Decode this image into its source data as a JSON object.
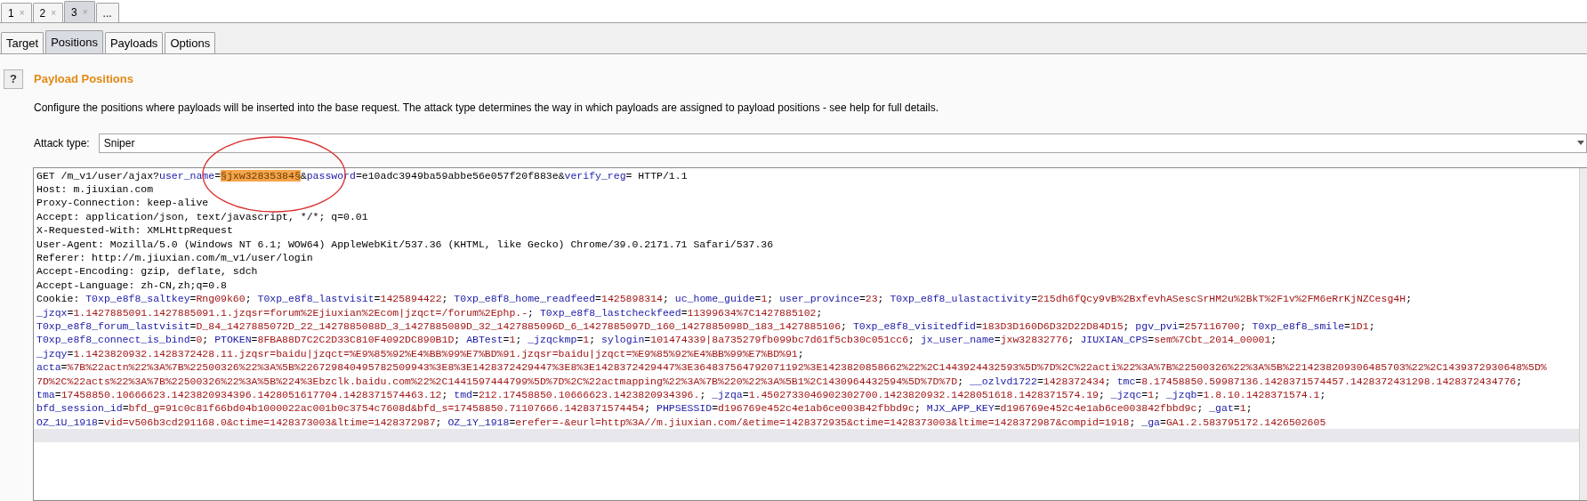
{
  "top_tabs": [
    {
      "label": "1",
      "close": "×",
      "selected": false
    },
    {
      "label": "2",
      "close": "×",
      "selected": false
    },
    {
      "label": "3",
      "close": "×",
      "selected": true
    },
    {
      "label": "...",
      "selected": false
    }
  ],
  "sub_tabs": [
    {
      "label": "Target",
      "selected": false
    },
    {
      "label": "Positions",
      "selected": true
    },
    {
      "label": "Payloads",
      "selected": false
    },
    {
      "label": "Options",
      "selected": false
    }
  ],
  "help_button": "?",
  "section_title": "Payload Positions",
  "description": "Configure the positions where payloads will be inserted into the base request. The attack type determines the way in which payloads are assigned to payload positions - see help for full details.",
  "attack_type": {
    "label": "Attack type:",
    "value": "Sniper"
  },
  "request_lines": [
    [
      {
        "kind": "plain",
        "text": "GET /m_v1/user/ajax?"
      },
      {
        "kind": "name",
        "text": "user_name"
      },
      {
        "kind": "plain",
        "text": "="
      },
      {
        "kind": "marker",
        "text": "§jxw32835384§"
      },
      {
        "kind": "plain",
        "text": "&"
      },
      {
        "kind": "name",
        "text": "password"
      },
      {
        "kind": "plain",
        "text": "=e10adc3949ba59abbe56e057f20f883e&"
      },
      {
        "kind": "name",
        "text": "verify_reg"
      },
      {
        "kind": "plain",
        "text": "= HTTP/1.1"
      }
    ],
    [
      {
        "kind": "plain",
        "text": "Host: m.jiuxian.com"
      }
    ],
    [
      {
        "kind": "plain",
        "text": "Proxy-Connection: keep-alive"
      }
    ],
    [
      {
        "kind": "plain",
        "text": "Accept: application/json, text/javascript, */*; q=0.01"
      }
    ],
    [
      {
        "kind": "plain",
        "text": "X-Requested-With: XMLHttpRequest"
      }
    ],
    [
      {
        "kind": "plain",
        "text": "User-Agent: Mozilla/5.0 (Windows NT 6.1; WOW64) AppleWebKit/537.36 (KHTML, like Gecko) Chrome/39.0.2171.71 Safari/537.36"
      }
    ],
    [
      {
        "kind": "plain",
        "text": "Referer: http://m.jiuxian.com/m_v1/user/login"
      }
    ],
    [
      {
        "kind": "plain",
        "text": "Accept-Encoding: gzip, deflate, sdch"
      }
    ],
    [
      {
        "kind": "plain",
        "text": "Accept-Language: zh-CN,zh;q=0.8"
      }
    ],
    [
      {
        "kind": "plain",
        "text": "Cookie: "
      },
      {
        "kind": "name",
        "text": "T0xp_e8f8_saltkey"
      },
      {
        "kind": "plain",
        "text": "="
      },
      {
        "kind": "value",
        "text": "Rng09k60"
      },
      {
        "kind": "plain",
        "text": "; "
      },
      {
        "kind": "name",
        "text": "T0xp_e8f8_lastvisit"
      },
      {
        "kind": "plain",
        "text": "="
      },
      {
        "kind": "value",
        "text": "1425894422"
      },
      {
        "kind": "plain",
        "text": "; "
      },
      {
        "kind": "name",
        "text": "T0xp_e8f8_home_readfeed"
      },
      {
        "kind": "plain",
        "text": "="
      },
      {
        "kind": "value",
        "text": "1425898314"
      },
      {
        "kind": "plain",
        "text": "; "
      },
      {
        "kind": "name",
        "text": "uc_home_guide"
      },
      {
        "kind": "plain",
        "text": "="
      },
      {
        "kind": "value",
        "text": "1"
      },
      {
        "kind": "plain",
        "text": "; "
      },
      {
        "kind": "name",
        "text": "user_province"
      },
      {
        "kind": "plain",
        "text": "="
      },
      {
        "kind": "value",
        "text": "23"
      },
      {
        "kind": "plain",
        "text": "; "
      },
      {
        "kind": "name",
        "text": "T0xp_e8f8_ulastactivity"
      },
      {
        "kind": "plain",
        "text": "="
      },
      {
        "kind": "value",
        "text": "215dh6fQcy9vB%2BxfevhASescSrHM2u%2BkT%2F1v%2FM6eRrKjNZCesg4H"
      },
      {
        "kind": "plain",
        "text": ";"
      }
    ],
    [
      {
        "kind": "name",
        "text": "_jzqx"
      },
      {
        "kind": "plain",
        "text": "="
      },
      {
        "kind": "value",
        "text": "1.1427885091.1427885091.1.jzqsr=forum%2Ejiuxian%2Ecom|jzqct=/forum%2Ephp.-"
      },
      {
        "kind": "plain",
        "text": "; "
      },
      {
        "kind": "name",
        "text": "T0xp_e8f8_lastcheckfeed"
      },
      {
        "kind": "plain",
        "text": "="
      },
      {
        "kind": "value",
        "text": "11399634%7C1427885102"
      },
      {
        "kind": "plain",
        "text": ";"
      }
    ],
    [
      {
        "kind": "name",
        "text": "T0xp_e8f8_forum_lastvisit"
      },
      {
        "kind": "plain",
        "text": "="
      },
      {
        "kind": "value",
        "text": "D_84_1427885072D_22_1427885088D_3_1427885089D_32_1427885096D_6_1427885097D_160_1427885098D_183_1427885106"
      },
      {
        "kind": "plain",
        "text": "; "
      },
      {
        "kind": "name",
        "text": "T0xp_e8f8_visitedfid"
      },
      {
        "kind": "plain",
        "text": "="
      },
      {
        "kind": "value",
        "text": "183D3D160D6D32D22D84D15"
      },
      {
        "kind": "plain",
        "text": "; "
      },
      {
        "kind": "name",
        "text": "pgv_pvi"
      },
      {
        "kind": "plain",
        "text": "="
      },
      {
        "kind": "value",
        "text": "257116700"
      },
      {
        "kind": "plain",
        "text": "; "
      },
      {
        "kind": "name",
        "text": "T0xp_e8f8_smile"
      },
      {
        "kind": "plain",
        "text": "="
      },
      {
        "kind": "value",
        "text": "1D1"
      },
      {
        "kind": "plain",
        "text": ";"
      }
    ],
    [
      {
        "kind": "name",
        "text": "T0xp_e8f8_connect_is_bind"
      },
      {
        "kind": "plain",
        "text": "="
      },
      {
        "kind": "value",
        "text": "0"
      },
      {
        "kind": "plain",
        "text": "; "
      },
      {
        "kind": "name",
        "text": "PTOKEN"
      },
      {
        "kind": "plain",
        "text": "="
      },
      {
        "kind": "value",
        "text": "8FBA88D7C2C2D33C810F4092DC890B1D"
      },
      {
        "kind": "plain",
        "text": "; "
      },
      {
        "kind": "name",
        "text": "ABTest"
      },
      {
        "kind": "plain",
        "text": "="
      },
      {
        "kind": "value",
        "text": "1"
      },
      {
        "kind": "plain",
        "text": "; "
      },
      {
        "kind": "name",
        "text": "_jzqckmp"
      },
      {
        "kind": "plain",
        "text": "="
      },
      {
        "kind": "value",
        "text": "1"
      },
      {
        "kind": "plain",
        "text": "; "
      },
      {
        "kind": "name",
        "text": "sylogin"
      },
      {
        "kind": "plain",
        "text": "="
      },
      {
        "kind": "value",
        "text": "101474339|8a735279fb099bc7d61f5cb30c051cc6"
      },
      {
        "kind": "plain",
        "text": "; "
      },
      {
        "kind": "name",
        "text": "jx_user_name"
      },
      {
        "kind": "plain",
        "text": "="
      },
      {
        "kind": "value",
        "text": "jxw32832776"
      },
      {
        "kind": "plain",
        "text": "; "
      },
      {
        "kind": "name",
        "text": "JIUXIAN_CPS"
      },
      {
        "kind": "plain",
        "text": "="
      },
      {
        "kind": "value",
        "text": "sem%7Cbt_2014_00001"
      },
      {
        "kind": "plain",
        "text": ";"
      }
    ],
    [
      {
        "kind": "name",
        "text": "_jzqy"
      },
      {
        "kind": "plain",
        "text": "="
      },
      {
        "kind": "value",
        "text": "1.1423820932.1428372428.11.jzqsr=baidu|jzqct=%E9%85%92%E4%BB%99%E7%BD%91.jzqsr=baidu|jzqct=%E9%85%92%E4%BB%99%E7%BD%91"
      },
      {
        "kind": "plain",
        "text": ";"
      }
    ],
    [
      {
        "kind": "name",
        "text": "acta"
      },
      {
        "kind": "plain",
        "text": "="
      },
      {
        "kind": "value",
        "text": "%7B%22actn%22%3A%7B%22500326%22%3A%5B%226729840495782509943%3E8%3E1428372429447%3E8%3E1428372429447%3E364837564792071192%3E1423820858662%22%2C1443924432593%5D%7D%2C%22acti%22%3A%7B%22500326%22%3A%5B%2214238209306485703%22%2C1439372930648%5D%"
      }
    ],
    [
      {
        "kind": "value",
        "text": "7D%2C%22acts%22%3A%7B%22500326%22%3A%5B%224%3Ebzclk.baidu.com%22%2C1441597444799%5D%7D%2C%22actmapping%22%3A%7B%220%22%3A%5B1%2C1430964432594%5D%7D%7D"
      },
      {
        "kind": "plain",
        "text": "; "
      },
      {
        "kind": "name",
        "text": "__ozlvd1722"
      },
      {
        "kind": "plain",
        "text": "="
      },
      {
        "kind": "value",
        "text": "1428372434"
      },
      {
        "kind": "plain",
        "text": "; "
      },
      {
        "kind": "name",
        "text": "tmc"
      },
      {
        "kind": "plain",
        "text": "="
      },
      {
        "kind": "value",
        "text": "8.17458850.59987136.1428371574457.1428372431298.1428372434776"
      },
      {
        "kind": "plain",
        "text": ";"
      }
    ],
    [
      {
        "kind": "name",
        "text": "tma"
      },
      {
        "kind": "plain",
        "text": "="
      },
      {
        "kind": "value",
        "text": "17458850.10666623.1423820934396.1428051617704.1428371574463.12"
      },
      {
        "kind": "plain",
        "text": "; "
      },
      {
        "kind": "name",
        "text": "tmd"
      },
      {
        "kind": "plain",
        "text": "="
      },
      {
        "kind": "value",
        "text": "212.17458850.10666623.1423820934396."
      },
      {
        "kind": "plain",
        "text": "; "
      },
      {
        "kind": "name",
        "text": "_jzqa"
      },
      {
        "kind": "plain",
        "text": "="
      },
      {
        "kind": "value",
        "text": "1.4502733046902302700.1423820932.1428051618.1428371574.19"
      },
      {
        "kind": "plain",
        "text": "; "
      },
      {
        "kind": "name",
        "text": "_jzqc"
      },
      {
        "kind": "plain",
        "text": "="
      },
      {
        "kind": "value",
        "text": "1"
      },
      {
        "kind": "plain",
        "text": "; "
      },
      {
        "kind": "name",
        "text": "_jzqb"
      },
      {
        "kind": "plain",
        "text": "="
      },
      {
        "kind": "value",
        "text": "1.8.10.1428371574.1"
      },
      {
        "kind": "plain",
        "text": ";"
      }
    ],
    [
      {
        "kind": "name",
        "text": "bfd_session_id"
      },
      {
        "kind": "plain",
        "text": "="
      },
      {
        "kind": "value",
        "text": "bfd_g=91c0c81f66bd04b1000022ac001b0c3754c7608d&bfd_s=17458850.71107666.1428371574454"
      },
      {
        "kind": "plain",
        "text": "; "
      },
      {
        "kind": "name",
        "text": "PHPSESSID"
      },
      {
        "kind": "plain",
        "text": "="
      },
      {
        "kind": "value",
        "text": "d196769e452c4e1ab6ce003842fbbd9c"
      },
      {
        "kind": "plain",
        "text": "; "
      },
      {
        "kind": "name",
        "text": "MJX_APP_KEY"
      },
      {
        "kind": "plain",
        "text": "="
      },
      {
        "kind": "value",
        "text": "d196769e452c4e1ab6ce003842fbbd9c"
      },
      {
        "kind": "plain",
        "text": "; "
      },
      {
        "kind": "name",
        "text": "_gat"
      },
      {
        "kind": "plain",
        "text": "="
      },
      {
        "kind": "value",
        "text": "1"
      },
      {
        "kind": "plain",
        "text": ";"
      }
    ],
    [
      {
        "kind": "name",
        "text": "OZ_1U_1918"
      },
      {
        "kind": "plain",
        "text": "="
      },
      {
        "kind": "value",
        "text": "vid=v506b3cd291168.0&ctime=1428373003&ltime=1428372987"
      },
      {
        "kind": "plain",
        "text": "; "
      },
      {
        "kind": "name",
        "text": "OZ_1Y_1918"
      },
      {
        "kind": "plain",
        "text": "="
      },
      {
        "kind": "value",
        "text": "erefer=-&eurl=http%3A//m.jiuxian.com/&etime=1428372935&ctime=1428373003&ltime=1428372987&compid=1918"
      },
      {
        "kind": "plain",
        "text": "; "
      },
      {
        "kind": "name",
        "text": "_ga"
      },
      {
        "kind": "plain",
        "text": "="
      },
      {
        "kind": "value",
        "text": "GA1.2.583795172.1426502605"
      }
    ]
  ]
}
